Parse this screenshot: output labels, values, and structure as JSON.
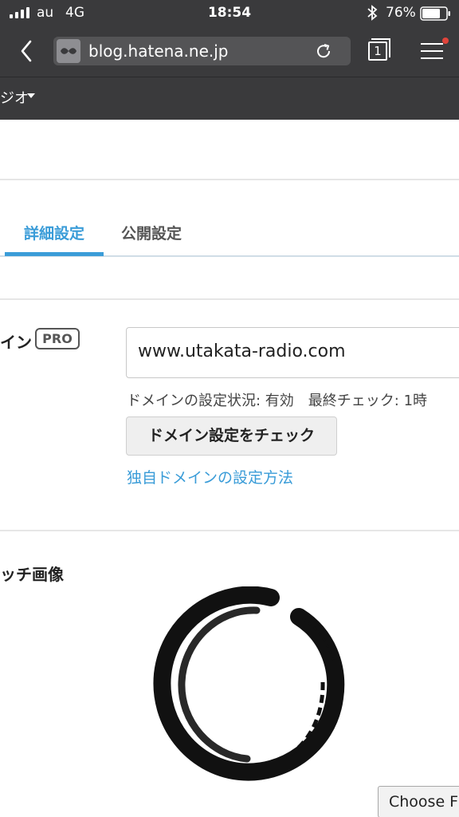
{
  "status_bar": {
    "carrier": "au",
    "network": "4G",
    "time": "18:54",
    "battery": "76%",
    "battery_level": 0.76
  },
  "browser": {
    "url": "blog.hatena.ne.jp",
    "tab_count": "1",
    "icons": [
      "back-icon",
      "site-icon",
      "reload-icon",
      "tabs-icon",
      "menu-icon"
    ],
    "menu_badge_color": "#e0443b"
  },
  "subnav": {
    "label": "ジオ"
  },
  "tabs": [
    {
      "label": "詳細設定",
      "active": true
    },
    {
      "label": "公開設定",
      "active": false
    }
  ],
  "domain": {
    "label": "イン",
    "badge": "PRO",
    "value": "www.utakata-radio.com",
    "status": "ドメインの設定状況: 有効　最終チェック: 1時",
    "check_button": "ドメイン設定をチェック",
    "help_link": "独自ドメインの設定方法"
  },
  "image": {
    "label": "ッチ画像",
    "choose_button": "Choose F"
  },
  "colors": {
    "accent": "#3a9cd8",
    "chrome": "#3a3a3c"
  }
}
